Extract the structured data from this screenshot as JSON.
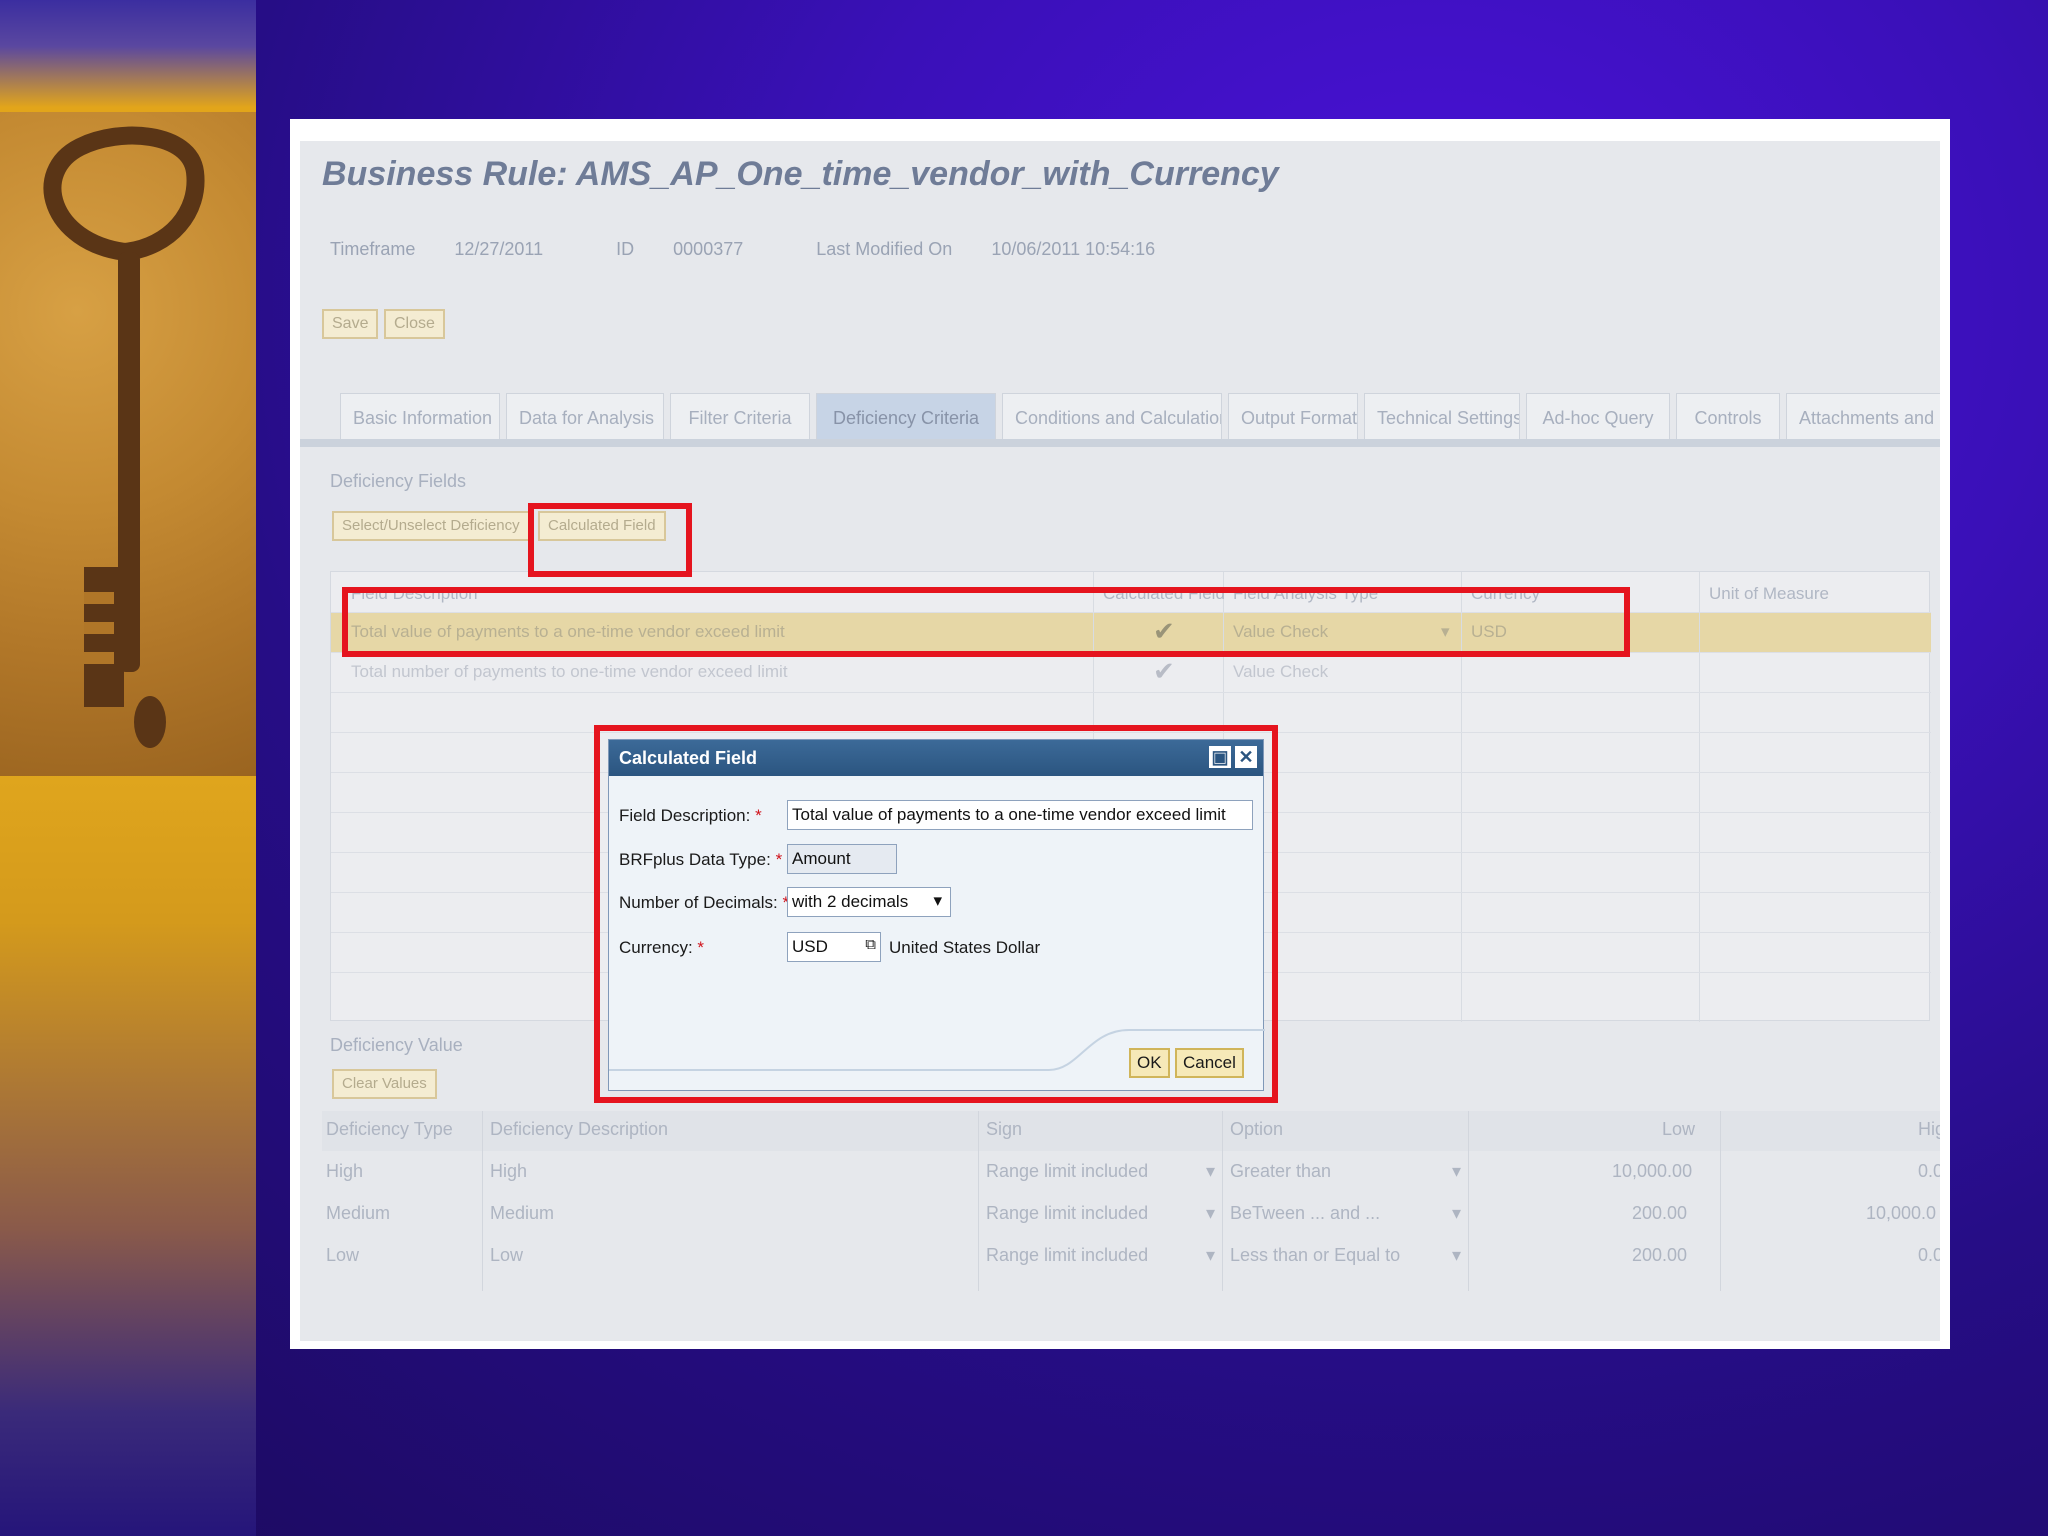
{
  "app": {
    "title": "Business Rule: AMS_AP_One_time_vendor_with_Currency",
    "meta": {
      "timeframe_label": "Timeframe",
      "timeframe_value": "12/27/2011",
      "id_label": "ID",
      "id_value": "0000377",
      "modified_label": "Last Modified On",
      "modified_value": "10/06/2011 10:54:16"
    },
    "toolbar": {
      "save": "Save",
      "close": "Close"
    },
    "tabs": [
      "Basic Information",
      "Data for Analysis",
      "Filter Criteria",
      "Deficiency Criteria",
      "Conditions and Calculations",
      "Output Format",
      "Technical Settings",
      "Ad-hoc Query",
      "Controls",
      "Attachments and"
    ],
    "active_tab": "Deficiency Criteria"
  },
  "deficiency_fields": {
    "section_title": "Deficiency Fields",
    "select_button": "Select/Unselect Deficiency",
    "calculated_button": "Calculated Field",
    "columns": [
      "Field Description",
      "Calculated Field",
      "Field Analysis Type",
      "Currency",
      "Unit of Measure"
    ],
    "rows": [
      {
        "description": "Total value of payments to a one-time vendor exceed limit",
        "calculated": "✔",
        "analysis_type": "Value Check",
        "currency": "USD"
      },
      {
        "description": "Total number of payments to one-time vendor exceed limit",
        "calculated": "✔",
        "analysis_type": "Value Check",
        "currency": ""
      }
    ]
  },
  "dialog": {
    "title": "Calculated Field",
    "field_description_label": "Field Description:",
    "field_description_value": "Total value of payments to a one-time vendor exceed limit",
    "data_type_label": "BRFplus Data Type:",
    "data_type_value": "Amount",
    "decimals_label": "Number of Decimals:",
    "decimals_value": "with 2 decimals",
    "currency_label": "Currency:",
    "currency_value": "USD",
    "currency_text": "United States Dollar",
    "required_mark": "*",
    "ok": "OK",
    "cancel": "Cancel"
  },
  "deficiency_value": {
    "section_title": "Deficiency Value",
    "clear_button": "Clear Values",
    "columns": [
      "Deficiency Type",
      "Deficiency Description",
      "Sign",
      "Option",
      "Low",
      "High"
    ],
    "rows": [
      {
        "type": "High",
        "description": "High",
        "sign": "Range limit included",
        "option": "Greater than",
        "low": "10,000.00",
        "high": "0.0"
      },
      {
        "type": "Medium",
        "description": "Medium",
        "sign": "Range limit included",
        "option": "BeTween ... and ...",
        "low": "200.00",
        "high": "10,000.0"
      },
      {
        "type": "Low",
        "description": "Low",
        "sign": "Range limit included",
        "option": "Less than or Equal to",
        "low": "200.00",
        "high": "0.0"
      }
    ]
  },
  "colors": {
    "highlight": "#e5141e",
    "background": "#3a10b8",
    "accent_gold": "#ecb21e"
  }
}
